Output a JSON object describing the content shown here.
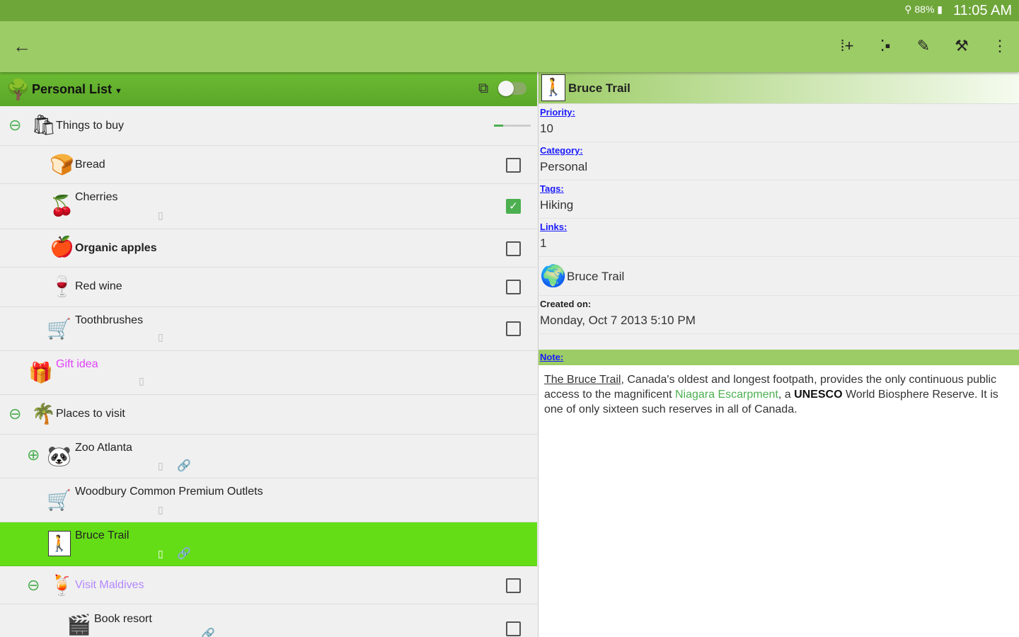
{
  "status_bar": {
    "time": "11:05 AM",
    "battery": "88%"
  },
  "app_bar": {
    "back_icon": "arrow-left-icon",
    "actions": [
      "add-below-icon",
      "add-child-icon",
      "edit-pencil-icon",
      "settings-icon",
      "more-vert-icon"
    ]
  },
  "list": {
    "title": "Personal List",
    "items": [
      {
        "label": "Things to buy",
        "progress": 0.25
      },
      {
        "label": "Bread",
        "checked": false
      },
      {
        "label": "Cherries",
        "checked": true
      },
      {
        "label": "Organic apples",
        "checked": false
      },
      {
        "label": "Red wine",
        "checked": false
      },
      {
        "label": "Toothbrushes",
        "checked": false
      },
      {
        "label": "Gift idea"
      },
      {
        "label": "Places to visit"
      },
      {
        "label": "Zoo Atlanta"
      },
      {
        "label": "Woodbury Common Premium Outlets"
      },
      {
        "label": "Bruce Trail"
      },
      {
        "label": "Visit Maldives",
        "checked": false
      },
      {
        "label": "Book resort",
        "checked": false
      }
    ]
  },
  "detail": {
    "title": "Bruce Trail",
    "priority_label": "Priority:",
    "priority": "10",
    "category_label": "Category:",
    "category": "Personal",
    "tags_label": "Tags:",
    "tags": "Hiking",
    "links_label": "Links:",
    "links_count": "1",
    "link_name": "Bruce Trail",
    "created_label": "Created on:",
    "created_value": "Monday, Oct 7 2013 5:10 PM",
    "note_label": "Note:",
    "note": {
      "part1": "The Bruce Trail",
      "part2": ", Canada's oldest and longest footpath, provides the only continuous public access to the magnificent ",
      "part3": "Niagara Escarpment",
      "part4": ", a ",
      "part5": "UNESCO",
      "part6": " World Biosphere Reserve. It is one of only sixteen such reserves in all of Canada."
    }
  },
  "colors": {
    "toolbar": "#9ccc65",
    "status": "#6fa63a",
    "selected": "#64dd17"
  }
}
